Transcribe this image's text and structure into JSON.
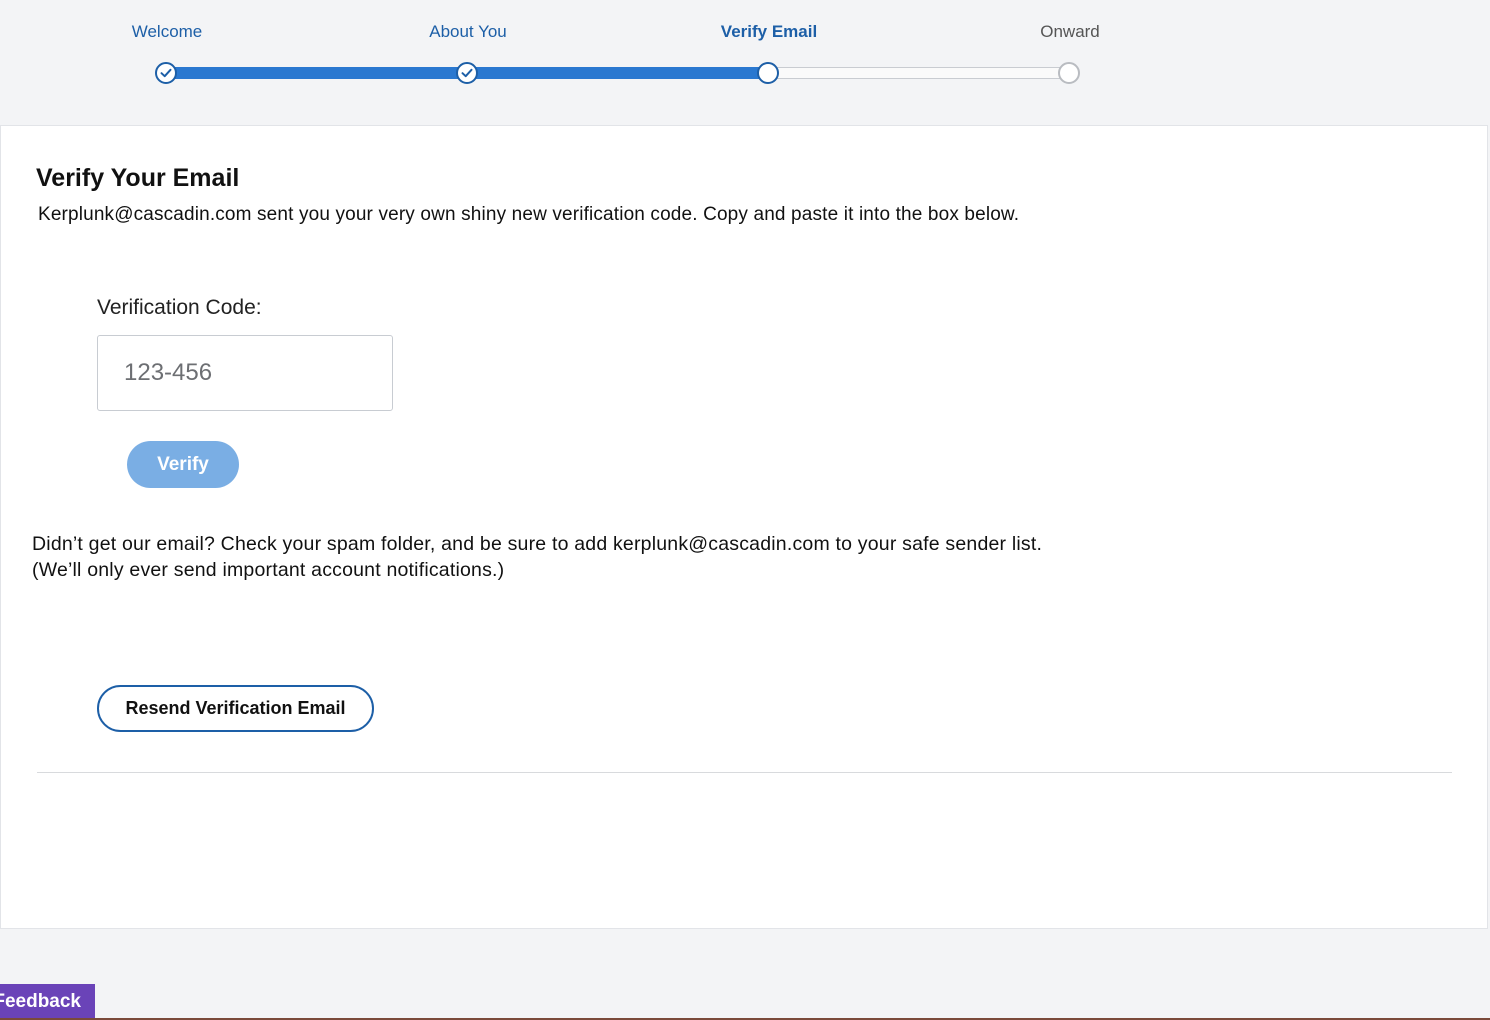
{
  "stepper": {
    "steps": [
      {
        "label": "Welcome",
        "state": "complete"
      },
      {
        "label": "About You",
        "state": "complete"
      },
      {
        "label": "Verify Email",
        "state": "current"
      },
      {
        "label": "Onward",
        "state": "upcoming"
      }
    ],
    "progress_percent": 67,
    "check_icon": "check-icon"
  },
  "verify": {
    "title": "Verify Your Email",
    "description": "Kerplunk@cascadin.com sent you your very own shiny new verification code. Copy and paste it into the box below.",
    "code_label": "Verification Code:",
    "code_placeholder": "123-456",
    "code_value": "",
    "verify_button": "Verify",
    "help_line1": "Didn’t get our email? Check your spam folder, and be sure to add kerplunk@cascadin.com to your safe sender list.",
    "help_line2": "(We’ll only ever send important account notifications.)",
    "resend_button": "Resend Verification Email"
  },
  "feedback": {
    "label": "Feedback"
  },
  "colors": {
    "accent": "#1d5fa7",
    "progress_fill": "#2a78d0",
    "verify_button_bg": "#7aaee4",
    "feedback_bg": "#6a43b8",
    "page_bg": "#f3f4f6"
  }
}
